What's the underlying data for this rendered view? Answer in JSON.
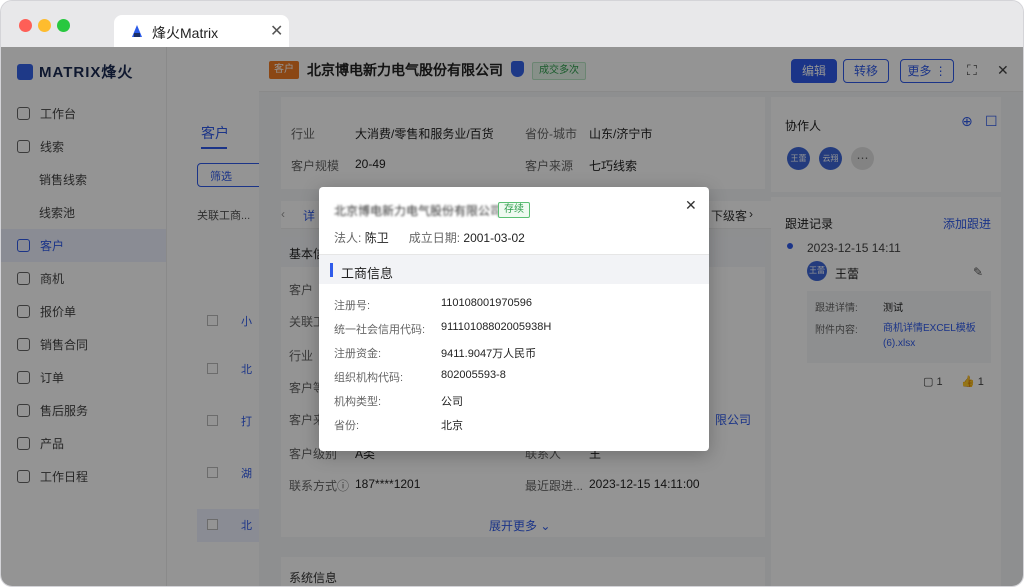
{
  "browser": {
    "tab_title": "烽火Matrix"
  },
  "brand": {
    "name": "MATRIX烽火"
  },
  "sidebar": {
    "items": [
      {
        "label": "工作台"
      },
      {
        "label": "线索"
      },
      {
        "label": "销售线索"
      },
      {
        "label": "线索池"
      },
      {
        "label": "客户"
      },
      {
        "label": "商机"
      },
      {
        "label": "报价单"
      },
      {
        "label": "销售合同"
      },
      {
        "label": "订单"
      },
      {
        "label": "售后服务"
      },
      {
        "label": "产品"
      },
      {
        "label": "工作日程"
      }
    ]
  },
  "list_panel": {
    "tab_label": "客户",
    "filter_label": "筛选",
    "related_label": "关联工商...",
    "rows": [
      "小",
      "北",
      "打",
      "湖",
      "北"
    ]
  },
  "drawer": {
    "tag": "客户",
    "company": "北京博电新力电气股份有限公司",
    "status": "成交多次",
    "edit": "编辑",
    "transfer": "转移",
    "more": "更多",
    "industry_key": "行业",
    "industry_val": "大消费/零售和服务业/百货",
    "region_key": "省份-城市",
    "region_val": "山东/济宁市",
    "scale_key": "客户规模",
    "scale_val": "20-49",
    "source_key": "客户来源",
    "source_val": "七巧线索",
    "basic_label": "基本信",
    "customer_label": "客户",
    "related_label": "关联工",
    "industry_short": "行业",
    "level_label": "客户等",
    "source_short": "客户来",
    "grade_key": "客户级别",
    "grade_val": "A类",
    "contact_key": "联系人",
    "contact_val": "王",
    "phone_key": "联系方式",
    "phone_val": "187****1201",
    "last_follow_key": "最近跟进...",
    "last_follow_val": "2023-12-15 14:11:00",
    "expand_more": "展开更多",
    "system_info": "系统信息",
    "company_tail": "限公司",
    "subtab_detail": "详",
    "subtab_lower": "下级客"
  },
  "collaborators": {
    "title": "协作人",
    "avatars": [
      "王蕾",
      "云翔"
    ]
  },
  "follow": {
    "title": "跟进记录",
    "add": "添加跟进",
    "time": "2023-12-15 14:11",
    "user": "王蕾",
    "user_short": "王蕾",
    "detail_key": "跟进详情:",
    "detail_val": "测试",
    "attach_key": "附件内容:",
    "attach_val": "商机详情EXCEL模板(6).xlsx",
    "comments": "1",
    "likes": "1"
  },
  "modal": {
    "company": "北京博电新力电气股份有限公司",
    "status": "存续",
    "legal_key": "法人:",
    "legal_val": "陈卫",
    "founded_key": "成立日期:",
    "founded_val": "2001-03-02",
    "section": "工商信息",
    "fields": [
      {
        "k": "注册号:",
        "v": "110108001970596"
      },
      {
        "k": "统一社会信用代码:",
        "v": "91110108802005938H"
      },
      {
        "k": "注册资金:",
        "v": "9411.9047万人民币"
      },
      {
        "k": "组织机构代码:",
        "v": "802005593-8"
      },
      {
        "k": "机构类型:",
        "v": "公司"
      },
      {
        "k": "省份:",
        "v": "北京"
      }
    ]
  }
}
